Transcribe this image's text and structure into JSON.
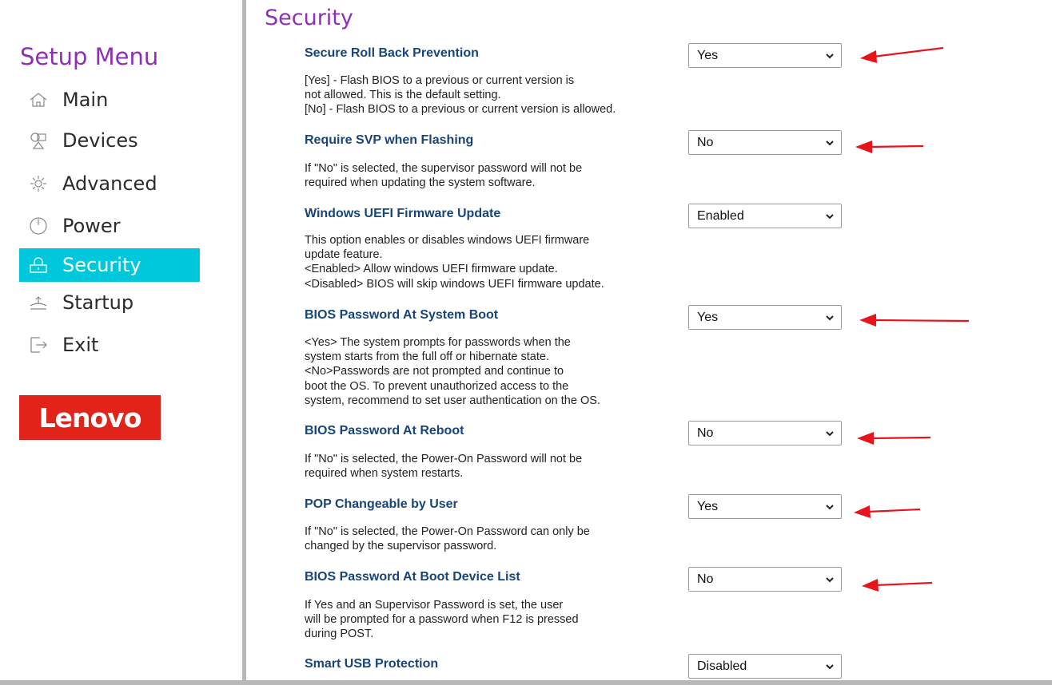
{
  "sidebar": {
    "title": "Setup Menu",
    "items": [
      {
        "label": "Main",
        "icon": "home-icon",
        "active": false
      },
      {
        "label": "Devices",
        "icon": "devices-icon",
        "active": false
      },
      {
        "label": "Advanced",
        "icon": "advanced-icon",
        "active": false
      },
      {
        "label": "Power",
        "icon": "power-icon",
        "active": false
      },
      {
        "label": "Security",
        "icon": "lock-icon",
        "active": true
      },
      {
        "label": "Startup",
        "icon": "startup-icon",
        "active": false
      },
      {
        "label": "Exit",
        "icon": "exit-icon",
        "active": false
      }
    ],
    "logo": "Lenovo"
  },
  "main": {
    "title": "Security",
    "settings": [
      {
        "label": "Secure Roll Back Prevention",
        "value": "Yes",
        "description": "[Yes] - Flash BIOS to a previous or current version is\nnot allowed. This is the default setting.\n[No] - Flash BIOS to a previous or current version is allowed."
      },
      {
        "label": "Require SVP when Flashing",
        "value": "No",
        "description": "If \"No\" is selected, the supervisor password will not be\nrequired when updating the system software."
      },
      {
        "label": "Windows UEFI Firmware Update",
        "value": "Enabled",
        "description": "This option enables or disables windows UEFI firmware\nupdate feature.\n<Enabled> Allow windows UEFI firmware update.\n<Disabled> BIOS will skip windows UEFI firmware update."
      },
      {
        "label": "BIOS Password At System Boot",
        "value": "Yes",
        "description": "<Yes> The system prompts for passwords when the\nsystem starts from the full off or hibernate state.\n<No>Passwords are not prompted and continue to\nboot the OS. To prevent unauthorized access to the\nsystem, recommend to set user authentication on the OS."
      },
      {
        "label": "BIOS Password At Reboot",
        "value": "No",
        "description": "If \"No\" is selected, the Power-On Password will not be\nrequired when system restarts."
      },
      {
        "label": "POP Changeable by User",
        "value": "Yes",
        "description": "If \"No\" is selected, the Power-On Password can only be\nchanged by the supervisor password."
      },
      {
        "label": "BIOS Password At Boot Device List",
        "value": "No",
        "description": "If Yes and an Supervisor Password is set, the user\nwill be prompted for a password when F12 is pressed\nduring POST."
      },
      {
        "label": "Smart USB Protection",
        "value": "Disabled",
        "description": ""
      }
    ]
  },
  "colors": {
    "accent": "#8e2fb5",
    "active_bg": "#00c8dc",
    "label": "#17457a",
    "logo_bg": "#e2231a",
    "arrow": "#e8141b"
  }
}
